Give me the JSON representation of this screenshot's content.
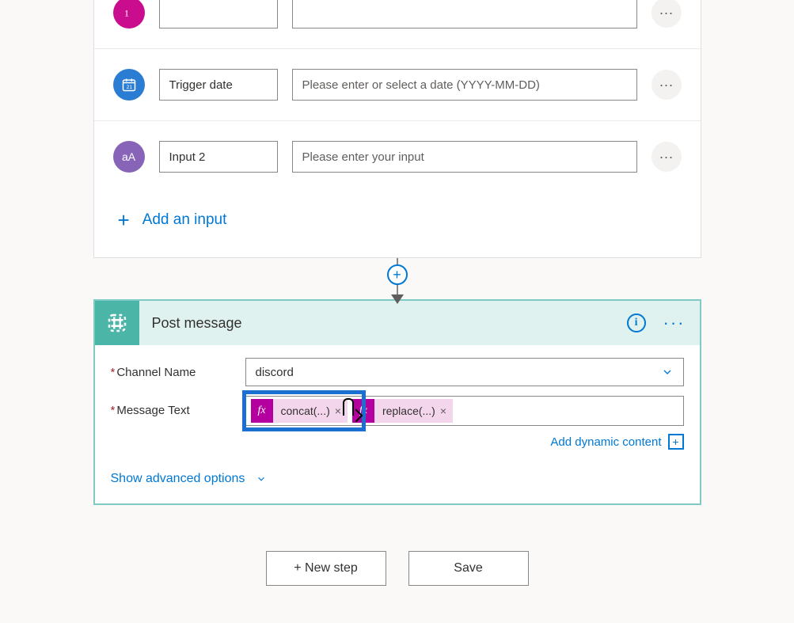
{
  "trigger": {
    "params": [
      {
        "name": "",
        "placeholder": ""
      },
      {
        "name": "Trigger date",
        "placeholder": "Please enter or select a date (YYYY-MM-DD)"
      },
      {
        "name": "Input 2",
        "placeholder": "Please enter your input"
      }
    ],
    "add_input_label": "Add an input"
  },
  "action": {
    "title": "Post message",
    "fields": {
      "channel": {
        "label": "Channel Name",
        "value": "discord"
      },
      "message": {
        "label": "Message Text",
        "tokens": [
          {
            "expr": "concat(...)"
          },
          {
            "expr": "replace(...)"
          }
        ]
      }
    },
    "dynamic_link": "Add dynamic content",
    "advanced_link": "Show advanced options"
  },
  "footer": {
    "new_step": "+ New step",
    "save": "Save"
  },
  "glyphs": {
    "fx": "fx",
    "ellipsis": "···",
    "plus": "+",
    "x": "×",
    "info": "i",
    "box_plus": "+"
  }
}
